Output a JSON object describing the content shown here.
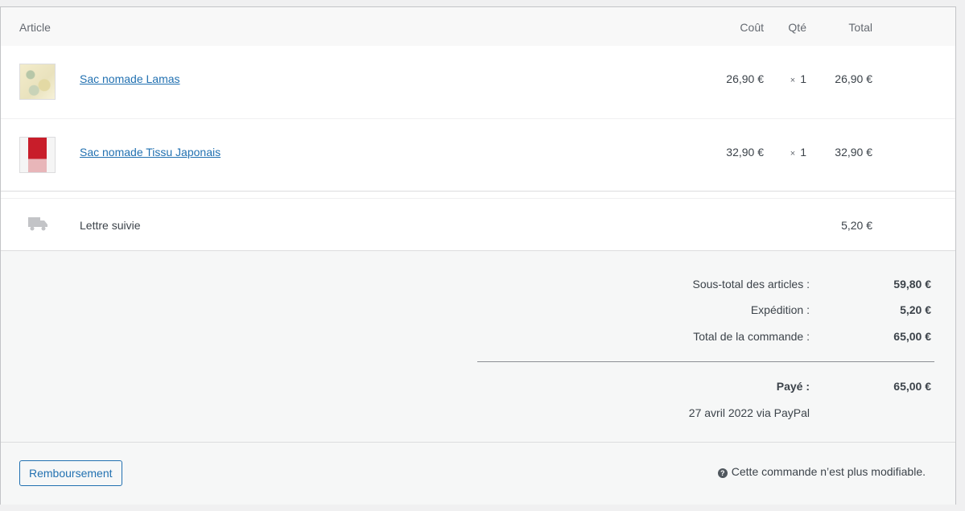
{
  "columns": {
    "article": "Article",
    "cost": "Coût",
    "qty": "Qté",
    "total": "Total"
  },
  "items": [
    {
      "name": "Sac nomade Lamas",
      "cost": "26,90 €",
      "qty_symbol": "×",
      "qty": "1",
      "total": "26,90 €",
      "thumb_icon": "product-thumbnail-lamas"
    },
    {
      "name": "Sac nomade Tissu Japonais",
      "cost": "32,90 €",
      "qty_symbol": "×",
      "qty": "1",
      "total": "32,90 €",
      "thumb_icon": "product-thumbnail-japonais"
    }
  ],
  "shipping": {
    "icon": "truck-icon",
    "name": "Lettre suivie",
    "total": "5,20 €"
  },
  "totals": {
    "subtotal_label": "Sous-total des articles :",
    "subtotal_value": "59,80 €",
    "shipping_label": "Expédition :",
    "shipping_value": "5,20 €",
    "order_total_label": "Total de la commande :",
    "order_total_value": "65,00 €",
    "paid_label": "Payé :",
    "paid_value": "65,00 €",
    "paid_note": "27 avril 2022 via PayPal"
  },
  "footer": {
    "refund_button": "Remboursement",
    "notice_icon": "help-icon",
    "notice_symbol": "?",
    "notice_text": "Cette commande n’est plus modifiable."
  },
  "colors": {
    "link": "#2271b1",
    "text": "#3c434a",
    "muted": "#646970"
  }
}
